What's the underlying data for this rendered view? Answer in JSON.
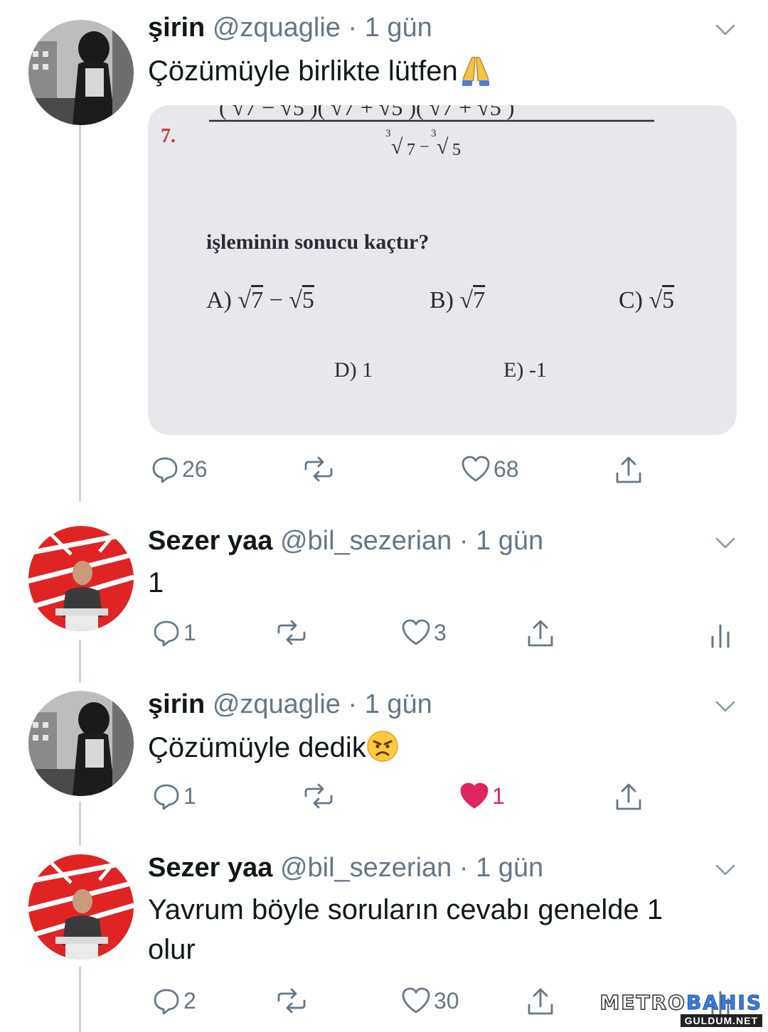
{
  "colors": {
    "like_active": "#e0245e",
    "muted": "#657786",
    "thread_line": "#c9d3da"
  },
  "tweets": [
    {
      "name": "şirin",
      "handle": "@zquaglie",
      "time": "· 1 gün",
      "text": "Çözümüyle birlikte lütfen",
      "emoji": "folded-hands",
      "media": {
        "question_number": "7.",
        "radicand_a": "7",
        "radicand_b": "5",
        "index": "3",
        "question": "işleminin sonucu kaçtır?",
        "options": {
          "a": "A)",
          "b": "B)",
          "c": "C)",
          "d": "D) 1",
          "e": "E) -1"
        }
      },
      "replies": "26",
      "likes": "68"
    },
    {
      "name": "Sezer yaa",
      "handle": "@bil_sezerian",
      "time": "· 1 gün",
      "text": "1",
      "replies": "1",
      "likes": "3"
    },
    {
      "name": "şirin",
      "handle": "@zquaglie",
      "time": "· 1 gün",
      "text": "Çözümüyle dedik",
      "emoji": "angry-face",
      "replies": "1",
      "likes": "1",
      "liked": true
    },
    {
      "name": "Sezer yaa",
      "handle": "@bil_sezerian",
      "time": "· 1 gün",
      "text": "Yavrum böyle soruların cevabı genelde 1 olur",
      "replies": "2",
      "likes": "30"
    }
  ],
  "watermark": {
    "part1": "METRO",
    "part2": "BAHIS",
    "sub": "GULDUM.NET"
  }
}
